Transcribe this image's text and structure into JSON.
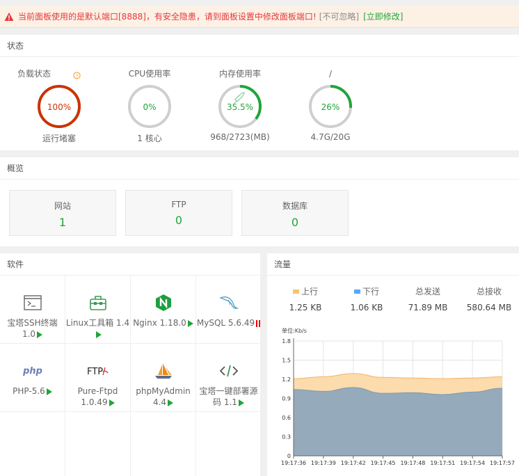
{
  "alert": {
    "message": "当前面板使用的是默认端口[8888]，有安全隐患，请到面板设置中修改面板端口!",
    "ignore": "[不可忽略]",
    "fix": "[立即修改]"
  },
  "status": {
    "title": "状态",
    "gauges": [
      {
        "label": "负载状态",
        "value": "100%",
        "percent": 100,
        "sub": "运行堵塞",
        "color": "#cc3300",
        "help": true
      },
      {
        "label": "CPU使用率",
        "value": "0%",
        "percent": 0,
        "sub": "1 核心",
        "color": "#20a53a",
        "help": false
      },
      {
        "label": "内存使用率",
        "value": "35.5%",
        "percent": 35.5,
        "sub": "968/2723(MB)",
        "color": "#20a53a",
        "help": false,
        "rocket": true
      },
      {
        "label": "/",
        "value": "26%",
        "percent": 26,
        "sub": "4.7G/20G",
        "color": "#20a53a",
        "help": false
      }
    ]
  },
  "overview": {
    "title": "概览",
    "boxes": [
      {
        "label": "网站",
        "value": "1"
      },
      {
        "label": "FTP",
        "value": "0"
      },
      {
        "label": "数据库",
        "value": "0"
      }
    ]
  },
  "software": {
    "title": "软件",
    "items": [
      {
        "name": "宝塔SSH终端 1.0",
        "icon": "terminal-icon",
        "state": "play"
      },
      {
        "name": "Linux工具箱 1.4",
        "icon": "toolbox-icon",
        "state": "play"
      },
      {
        "name": "Nginx 1.18.0",
        "icon": "nginx-icon",
        "state": "play"
      },
      {
        "name": "MySQL 5.6.49",
        "icon": "mysql-dolphin-icon",
        "state": "pause"
      },
      {
        "name": "PHP-5.6",
        "icon": "php-icon",
        "state": "play"
      },
      {
        "name": "Pure-Ftpd 1.0.49",
        "icon": "ftp-icon",
        "state": "play"
      },
      {
        "name": "phpMyAdmin 4.4",
        "icon": "sailboat-icon",
        "state": "play"
      },
      {
        "name": "宝塔一键部署源码 1.1",
        "icon": "code-icon",
        "state": "play"
      }
    ]
  },
  "traffic": {
    "title": "流量",
    "stats": [
      {
        "label": "上行",
        "value": "1.25 KB",
        "swatch": "#f8c372"
      },
      {
        "label": "下行",
        "value": "1.06 KB",
        "swatch": "#52a9ff"
      },
      {
        "label": "总发送",
        "value": "71.89 MB"
      },
      {
        "label": "总接收",
        "value": "580.64 MB"
      }
    ],
    "chart_data": {
      "type": "area",
      "ylabel": "单位:Kb/s",
      "ylim": [
        0,
        1.8
      ],
      "yticks": [
        0,
        0.3,
        0.6,
        0.9,
        1.2,
        1.5,
        1.8
      ],
      "x": [
        "19:17:36",
        "19:17:39",
        "19:17:42",
        "19:17:45",
        "19:17:48",
        "19:17:51",
        "19:17:54",
        "19:17:57"
      ],
      "grid": true,
      "series": [
        {
          "name": "上行",
          "color": "#fcd9a8",
          "values": [
            1.21,
            1.24,
            1.29,
            1.23,
            1.22,
            1.21,
            1.22,
            1.24
          ]
        },
        {
          "name": "下行",
          "color": "#8fa9bd",
          "values": [
            1.04,
            1.01,
            1.07,
            0.98,
            0.99,
            0.96,
            1.0,
            1.06
          ]
        }
      ]
    }
  }
}
